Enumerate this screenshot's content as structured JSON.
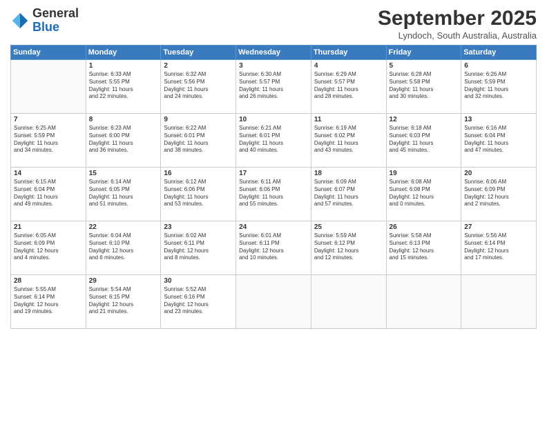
{
  "header": {
    "logo_line1": "General",
    "logo_line2": "Blue",
    "month": "September 2025",
    "location": "Lyndoch, South Australia, Australia"
  },
  "days_of_week": [
    "Sunday",
    "Monday",
    "Tuesday",
    "Wednesday",
    "Thursday",
    "Friday",
    "Saturday"
  ],
  "weeks": [
    [
      {
        "day": "",
        "info": ""
      },
      {
        "day": "1",
        "info": "Sunrise: 6:33 AM\nSunset: 5:55 PM\nDaylight: 11 hours\nand 22 minutes."
      },
      {
        "day": "2",
        "info": "Sunrise: 6:32 AM\nSunset: 5:56 PM\nDaylight: 11 hours\nand 24 minutes."
      },
      {
        "day": "3",
        "info": "Sunrise: 6:30 AM\nSunset: 5:57 PM\nDaylight: 11 hours\nand 26 minutes."
      },
      {
        "day": "4",
        "info": "Sunrise: 6:29 AM\nSunset: 5:57 PM\nDaylight: 11 hours\nand 28 minutes."
      },
      {
        "day": "5",
        "info": "Sunrise: 6:28 AM\nSunset: 5:58 PM\nDaylight: 11 hours\nand 30 minutes."
      },
      {
        "day": "6",
        "info": "Sunrise: 6:26 AM\nSunset: 5:59 PM\nDaylight: 11 hours\nand 32 minutes."
      }
    ],
    [
      {
        "day": "7",
        "info": "Sunrise: 6:25 AM\nSunset: 5:59 PM\nDaylight: 11 hours\nand 34 minutes."
      },
      {
        "day": "8",
        "info": "Sunrise: 6:23 AM\nSunset: 6:00 PM\nDaylight: 11 hours\nand 36 minutes."
      },
      {
        "day": "9",
        "info": "Sunrise: 6:22 AM\nSunset: 6:01 PM\nDaylight: 11 hours\nand 38 minutes."
      },
      {
        "day": "10",
        "info": "Sunrise: 6:21 AM\nSunset: 6:01 PM\nDaylight: 11 hours\nand 40 minutes."
      },
      {
        "day": "11",
        "info": "Sunrise: 6:19 AM\nSunset: 6:02 PM\nDaylight: 11 hours\nand 43 minutes."
      },
      {
        "day": "12",
        "info": "Sunrise: 6:18 AM\nSunset: 6:03 PM\nDaylight: 11 hours\nand 45 minutes."
      },
      {
        "day": "13",
        "info": "Sunrise: 6:16 AM\nSunset: 6:04 PM\nDaylight: 11 hours\nand 47 minutes."
      }
    ],
    [
      {
        "day": "14",
        "info": "Sunrise: 6:15 AM\nSunset: 6:04 PM\nDaylight: 11 hours\nand 49 minutes."
      },
      {
        "day": "15",
        "info": "Sunrise: 6:14 AM\nSunset: 6:05 PM\nDaylight: 11 hours\nand 51 minutes."
      },
      {
        "day": "16",
        "info": "Sunrise: 6:12 AM\nSunset: 6:06 PM\nDaylight: 11 hours\nand 53 minutes."
      },
      {
        "day": "17",
        "info": "Sunrise: 6:11 AM\nSunset: 6:06 PM\nDaylight: 11 hours\nand 55 minutes."
      },
      {
        "day": "18",
        "info": "Sunrise: 6:09 AM\nSunset: 6:07 PM\nDaylight: 11 hours\nand 57 minutes."
      },
      {
        "day": "19",
        "info": "Sunrise: 6:08 AM\nSunset: 6:08 PM\nDaylight: 12 hours\nand 0 minutes."
      },
      {
        "day": "20",
        "info": "Sunrise: 6:06 AM\nSunset: 6:09 PM\nDaylight: 12 hours\nand 2 minutes."
      }
    ],
    [
      {
        "day": "21",
        "info": "Sunrise: 6:05 AM\nSunset: 6:09 PM\nDaylight: 12 hours\nand 4 minutes."
      },
      {
        "day": "22",
        "info": "Sunrise: 6:04 AM\nSunset: 6:10 PM\nDaylight: 12 hours\nand 6 minutes."
      },
      {
        "day": "23",
        "info": "Sunrise: 6:02 AM\nSunset: 6:11 PM\nDaylight: 12 hours\nand 8 minutes."
      },
      {
        "day": "24",
        "info": "Sunrise: 6:01 AM\nSunset: 6:11 PM\nDaylight: 12 hours\nand 10 minutes."
      },
      {
        "day": "25",
        "info": "Sunrise: 5:59 AM\nSunset: 6:12 PM\nDaylight: 12 hours\nand 12 minutes."
      },
      {
        "day": "26",
        "info": "Sunrise: 5:58 AM\nSunset: 6:13 PM\nDaylight: 12 hours\nand 15 minutes."
      },
      {
        "day": "27",
        "info": "Sunrise: 5:56 AM\nSunset: 6:14 PM\nDaylight: 12 hours\nand 17 minutes."
      }
    ],
    [
      {
        "day": "28",
        "info": "Sunrise: 5:55 AM\nSunset: 6:14 PM\nDaylight: 12 hours\nand 19 minutes."
      },
      {
        "day": "29",
        "info": "Sunrise: 5:54 AM\nSunset: 6:15 PM\nDaylight: 12 hours\nand 21 minutes."
      },
      {
        "day": "30",
        "info": "Sunrise: 5:52 AM\nSunset: 6:16 PM\nDaylight: 12 hours\nand 23 minutes."
      },
      {
        "day": "",
        "info": ""
      },
      {
        "day": "",
        "info": ""
      },
      {
        "day": "",
        "info": ""
      },
      {
        "day": "",
        "info": ""
      }
    ]
  ]
}
